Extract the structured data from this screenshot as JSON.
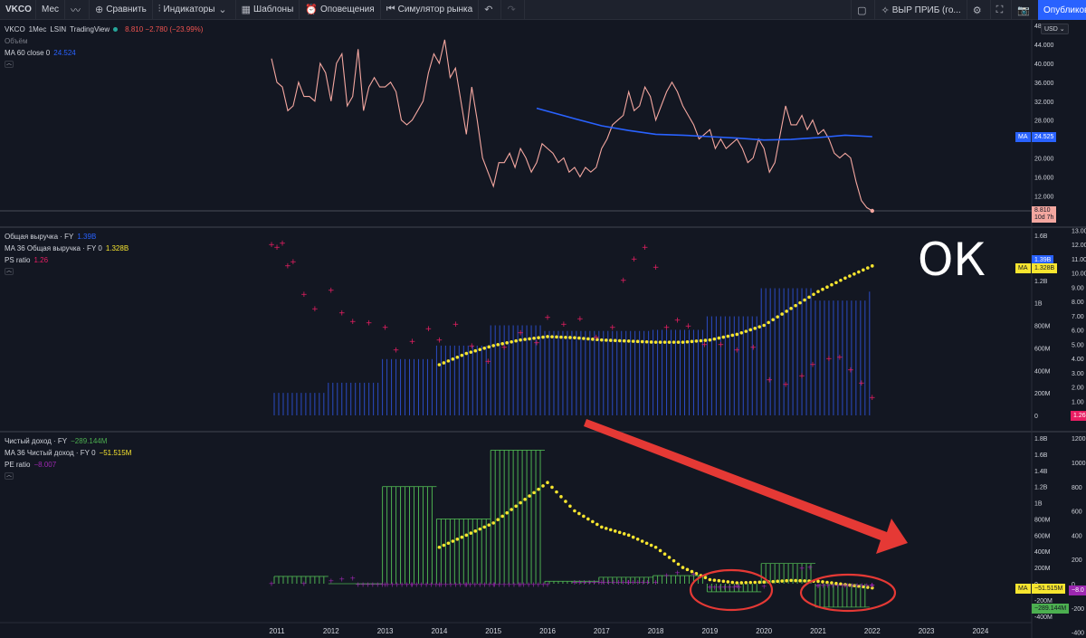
{
  "toolbar": {
    "symbol": "VKCO",
    "interval": "Мес",
    "compare": "Сравнить",
    "indicators": "Индикаторы",
    "templates": "Шаблоны",
    "alerts": "Оповещения",
    "replay": "Симулятор рынка",
    "right_select": "ВЫР ПРИБ (го...",
    "publish": "Опубликовать"
  },
  "pane1": {
    "title_symbol": "VKCO",
    "title_interval": "1Мес",
    "title_exchange": "LSIN",
    "title_source": "TradingView",
    "price_change": "8.810 −2.780 (−23.99%)",
    "volume_label": "Объём",
    "ma_label": "MA 60 close 0",
    "ma_value": "24.524",
    "currency": "USD",
    "ma_tag_label": "MA",
    "ma_tag_value": "24.525",
    "last_price": "8.810",
    "last_countdown": "10d 7h"
  },
  "pane2": {
    "rev_label": "Общая выручка · FY",
    "rev_value": "1.39B",
    "ma_label": "MA 36 Общая выручка · FY 0",
    "ma_value": "1.328B",
    "ps_label": "PS ratio",
    "ps_value": "1.26",
    "tag_rev": "1.39B",
    "tag_ma_label": "MA",
    "tag_ma": "1.328B",
    "tag_ps": "1.26"
  },
  "pane3": {
    "ni_label": "Чистый доход · FY",
    "ni_value": "−289.144M",
    "ma_label": "MA 36 Чистый доход · FY 0",
    "ma_value": "−51.515M",
    "pe_label": "PE ratio",
    "pe_value": "−8.007",
    "tag_ma_label": "MA",
    "tag_ma": "−51.515M",
    "tag_ni": "−289.144M",
    "tag_pe": "−8.0"
  },
  "annotation": {
    "ok_text": "ОК"
  },
  "colors": {
    "background": "#131722",
    "price": "#f4a7a0",
    "ma_blue": "#2962ff",
    "revenue_bars": "#2a4bc4",
    "ma_yellow": "#f7e52f",
    "ps_pink": "#e91e63",
    "income_bars": "#4caf50",
    "pe_purple": "#9c27b0",
    "arrow_red": "#e53935"
  },
  "chart_data": [
    {
      "type": "line",
      "title": "VKCO · 1Мес · LSIN",
      "x": [
        2010.9,
        2011.0,
        2011.1,
        2011.2,
        2011.3,
        2011.4,
        2011.5,
        2011.6,
        2011.7,
        2011.8,
        2011.9,
        2012.0,
        2012.1,
        2012.2,
        2012.3,
        2012.4,
        2012.5,
        2012.6,
        2012.7,
        2012.8,
        2012.9,
        2013.0,
        2013.1,
        2013.2,
        2013.3,
        2013.4,
        2013.5,
        2013.6,
        2013.7,
        2013.8,
        2013.9,
        2014.0,
        2014.1,
        2014.2,
        2014.3,
        2014.4,
        2014.5,
        2014.6,
        2014.7,
        2014.8,
        2014.9,
        2015.0,
        2015.1,
        2015.2,
        2015.3,
        2015.4,
        2015.5,
        2015.6,
        2015.7,
        2015.8,
        2015.9,
        2016.0,
        2016.1,
        2016.2,
        2016.3,
        2016.4,
        2016.5,
        2016.6,
        2016.7,
        2016.8,
        2016.9,
        2017.0,
        2017.1,
        2017.2,
        2017.3,
        2017.4,
        2017.5,
        2017.6,
        2017.7,
        2017.8,
        2017.9,
        2018.0,
        2018.1,
        2018.2,
        2018.3,
        2018.4,
        2018.5,
        2018.6,
        2018.7,
        2018.8,
        2018.9,
        2019.0,
        2019.1,
        2019.2,
        2019.3,
        2019.4,
        2019.5,
        2019.6,
        2019.7,
        2019.8,
        2019.9,
        2020.0,
        2020.1,
        2020.2,
        2020.3,
        2020.4,
        2020.5,
        2020.6,
        2020.7,
        2020.8,
        2020.9,
        2021.0,
        2021.1,
        2021.2,
        2021.3,
        2021.4,
        2021.5,
        2021.6,
        2021.7,
        2021.8,
        2021.9,
        2022.0
      ],
      "y": [
        41,
        36,
        35,
        30,
        31,
        36,
        33,
        33,
        32,
        40,
        38,
        32,
        40,
        42,
        31,
        33,
        43,
        30,
        35,
        37,
        35,
        35,
        36,
        34,
        28,
        27,
        28,
        30,
        32,
        38,
        42,
        40,
        45,
        37,
        39,
        32,
        25,
        35,
        28,
        20,
        17,
        14,
        19,
        19,
        21,
        18,
        22,
        20,
        17,
        19,
        23,
        22,
        21,
        19,
        20,
        17,
        18,
        16,
        18,
        17,
        18,
        22,
        24,
        27,
        28,
        29,
        34,
        30,
        31,
        35,
        33,
        28,
        31,
        34,
        36,
        34,
        31,
        29,
        27,
        24,
        25,
        26,
        22,
        24,
        22,
        23,
        24,
        22,
        19,
        20,
        24,
        22,
        17,
        19,
        25,
        31,
        27,
        27,
        29,
        26,
        28,
        25,
        26,
        24,
        21,
        20,
        21,
        20,
        15,
        11,
        9.5,
        8.81
      ],
      "ma_x": [
        2015.8,
        2016.5,
        2017.0,
        2017.5,
        2018.0,
        2018.5,
        2019.0,
        2019.5,
        2020.0,
        2020.5,
        2021.0,
        2021.5,
        2022.0
      ],
      "ma_y": [
        30.5,
        28.3,
        26.8,
        25.8,
        25.0,
        24.8,
        24.5,
        24.2,
        23.8,
        23.9,
        24.3,
        24.8,
        24.5
      ],
      "yticks": [
        "48.000",
        "44.000",
        "40.000",
        "36.000",
        "32.000",
        "28.000",
        "24.000",
        "20.000",
        "16.000",
        "12.000"
      ],
      "ylim": [
        8,
        49
      ]
    },
    {
      "type": "bar",
      "title": "Общая выручка · FY",
      "categories": [
        "2011",
        "2012",
        "2013",
        "2014",
        "2015",
        "2016",
        "2017",
        "2018",
        "2019",
        "2020",
        "2021"
      ],
      "revenue_bn": [
        0.2,
        0.29,
        0.5,
        0.62,
        0.8,
        0.75,
        0.75,
        0.76,
        0.88,
        1.13,
        1.02
      ],
      "ma_x": [
        2014.0,
        2014.5,
        2015.0,
        2015.5,
        2016.0,
        2016.5,
        2017.0,
        2017.5,
        2018.0,
        2018.5,
        2019.0,
        2019.5,
        2020.0,
        2020.5,
        2021.0,
        2021.5,
        2022.0
      ],
      "ma_bn": [
        0.45,
        0.55,
        0.62,
        0.67,
        0.7,
        0.69,
        0.67,
        0.66,
        0.65,
        0.65,
        0.67,
        0.72,
        0.8,
        0.95,
        1.1,
        1.22,
        1.328
      ],
      "ps_x": [
        2010.9,
        2011.0,
        2011.1,
        2011.2,
        2011.3,
        2011.5,
        2011.7,
        2012.0,
        2012.2,
        2012.4,
        2012.7,
        2013.0,
        2013.2,
        2013.5,
        2013.8,
        2014.0,
        2014.3,
        2014.6,
        2014.9,
        2015.2,
        2015.5,
        2015.8,
        2016.0,
        2016.3,
        2016.6,
        2016.9,
        2017.2,
        2017.4,
        2017.6,
        2017.8,
        2018.0,
        2018.2,
        2018.4,
        2018.6,
        2018.9,
        2019.2,
        2019.5,
        2019.8,
        2020.1,
        2020.4,
        2020.7,
        2020.9,
        2021.2,
        2021.4,
        2021.6,
        2021.8,
        2022.0
      ],
      "ps": [
        12.0,
        11.8,
        12.1,
        10.5,
        10.8,
        8.5,
        7.5,
        8.8,
        7.2,
        6.6,
        6.5,
        6.2,
        4.6,
        5.2,
        6.1,
        5.3,
        6.4,
        4.9,
        3.8,
        4.8,
        5.8,
        5.1,
        6.9,
        6.4,
        6.8,
        5.5,
        6.2,
        9.5,
        11.0,
        11.8,
        10.4,
        6.2,
        6.7,
        6.3,
        5.0,
        5.0,
        4.6,
        4.8,
        2.5,
        2.2,
        2.8,
        3.6,
        4.0,
        4.1,
        3.2,
        2.3,
        1.26
      ],
      "left_ticks": [
        "1.6B",
        "1.4B",
        "1.2B",
        "1B",
        "800M",
        "600M",
        "400M",
        "200M",
        "0"
      ],
      "right_ticks": [
        "13.00",
        "12.00",
        "11.00",
        "10.00",
        "9.00",
        "8.00",
        "7.00",
        "6.00",
        "5.00",
        "4.00",
        "3.00",
        "2.00",
        "1.00"
      ]
    },
    {
      "type": "bar",
      "title": "Чистый доход · FY",
      "categories": [
        "2011",
        "2012",
        "2013",
        "2014",
        "2015",
        "2016",
        "2017",
        "2018",
        "2019",
        "2020",
        "2021"
      ],
      "net_income_m": [
        90,
        0,
        1200,
        800,
        1650,
        30,
        80,
        100,
        -100,
        250,
        -289
      ],
      "ma_x": [
        2014.0,
        2014.5,
        2015.0,
        2015.5,
        2016.0,
        2016.5,
        2017.0,
        2017.5,
        2018.0,
        2018.5,
        2019.0,
        2019.5,
        2020.0,
        2020.5,
        2021.0,
        2021.5,
        2022.0
      ],
      "ma_m": [
        450,
        600,
        750,
        1000,
        1250,
        900,
        700,
        600,
        450,
        200,
        50,
        10,
        20,
        40,
        30,
        -10,
        -51.5
      ],
      "pe_x": [
        2010.9,
        2011.5,
        2012.0,
        2012.2,
        2012.4,
        2013.0,
        2013.5,
        2014.0,
        2014.5,
        2015.0,
        2015.5,
        2016.0,
        2016.5,
        2017.0,
        2017.5,
        2018.0,
        2018.2,
        2018.4,
        2018.7,
        2019.0,
        2019.5,
        2020.0,
        2020.7,
        2020.85,
        2021.0,
        2021.5,
        2022.0
      ],
      "pe": [
        5,
        5,
        25,
        40,
        48,
        -5,
        -5,
        -5,
        -5,
        -5,
        -5,
        -5,
        15,
        15,
        15,
        15,
        70,
        95,
        82,
        -25,
        -15,
        -20,
        130,
        137,
        -15,
        -10,
        -8.007
      ],
      "left_ticks": [
        "1.8B",
        "1.6B",
        "1.4B",
        "1.2B",
        "1B",
        "800M",
        "600M",
        "400M",
        "200M",
        "0",
        "-200M",
        "-400M"
      ],
      "right_ticks": [
        "1200",
        "1000",
        "800",
        "600",
        "400",
        "200",
        "0",
        "-200",
        "-400"
      ]
    }
  ],
  "time_axis": [
    "2011",
    "2012",
    "2013",
    "2014",
    "2015",
    "2016",
    "2017",
    "2018",
    "2019",
    "2020",
    "2021",
    "2022",
    "2023",
    "2024"
  ]
}
